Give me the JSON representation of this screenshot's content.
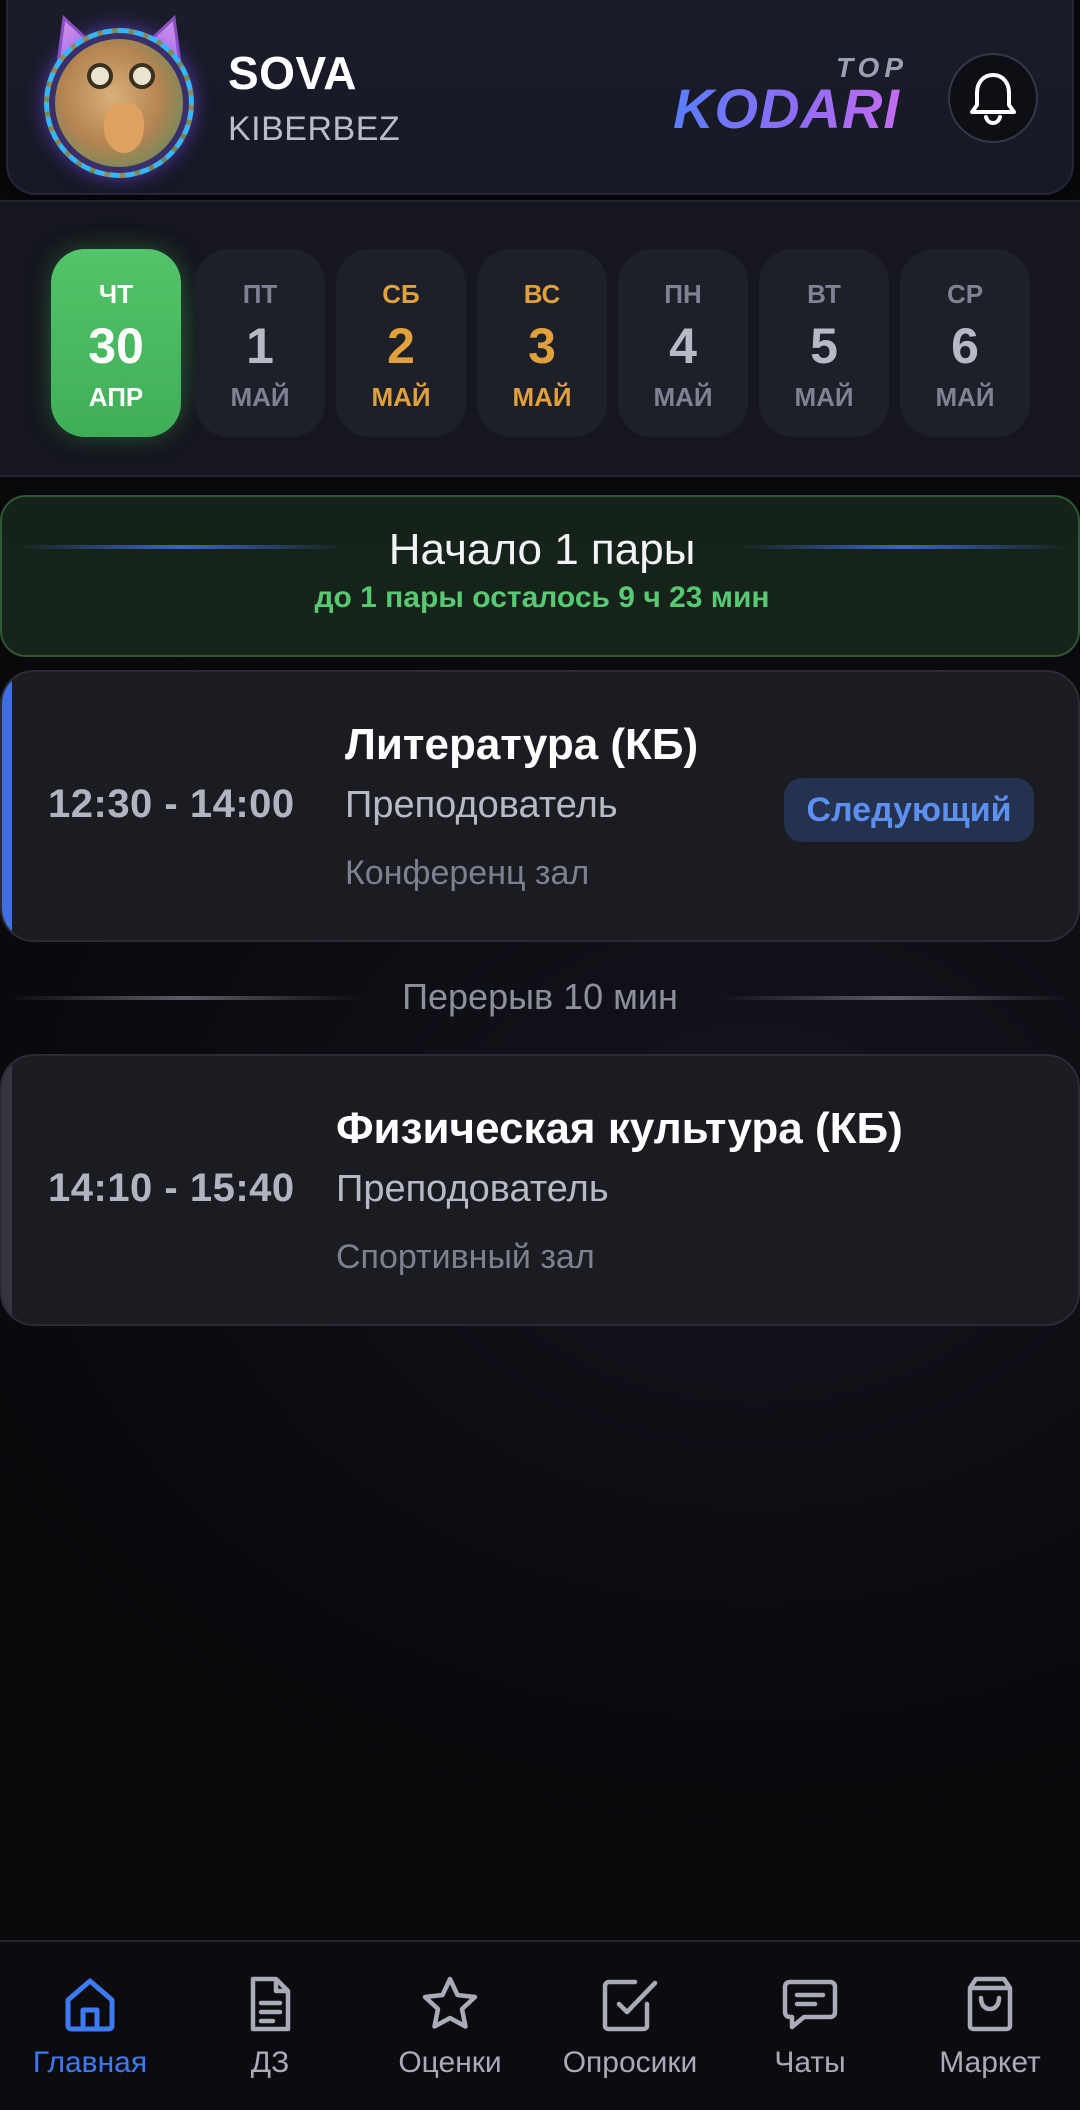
{
  "header": {
    "user_name": "SOVA",
    "group": "KIBERBEZ",
    "brand_top": "TOP",
    "brand_main": "KODARI"
  },
  "days": [
    {
      "dow": "ЧТ",
      "num": "30",
      "mon": "АПР",
      "state": "active"
    },
    {
      "dow": "ПТ",
      "num": "1",
      "mon": "МАЙ",
      "state": "normal"
    },
    {
      "dow": "СБ",
      "num": "2",
      "mon": "МАЙ",
      "state": "weekend"
    },
    {
      "dow": "ВС",
      "num": "3",
      "mon": "МАЙ",
      "state": "weekend"
    },
    {
      "dow": "ПН",
      "num": "4",
      "mon": "МАЙ",
      "state": "normal"
    },
    {
      "dow": "ВТ",
      "num": "5",
      "mon": "МАЙ",
      "state": "normal"
    },
    {
      "dow": "СР",
      "num": "6",
      "mon": "МАЙ",
      "state": "normal"
    }
  ],
  "banner": {
    "title": "Начало 1 пары",
    "subtitle": "до 1 пары осталось 9 ч 23 мин"
  },
  "lessons": [
    {
      "time": "12:30 - 14:00",
      "subject": "Литература (КБ)",
      "teacher": "Преподователь",
      "room": "Конференц зал",
      "badge": "Следующий"
    },
    {
      "time": "14:10 - 15:40",
      "subject": "Физическая культура (КБ)",
      "teacher": "Преподователь",
      "room": "Спортивный зал"
    }
  ],
  "break_label": "Перерыв 10 мин",
  "nav": [
    {
      "label": "Главная",
      "icon": "home-icon",
      "active": true
    },
    {
      "label": "ДЗ",
      "icon": "document-icon",
      "active": false
    },
    {
      "label": "Оценки",
      "icon": "star-icon",
      "active": false
    },
    {
      "label": "Опросики",
      "icon": "checkbox-icon",
      "active": false
    },
    {
      "label": "Чаты",
      "icon": "chat-icon",
      "active": false
    },
    {
      "label": "Маркет",
      "icon": "shopping-bag-icon",
      "active": false
    }
  ],
  "colors": {
    "accent_blue": "#3d7bf2",
    "active_day_green": "#4cbb63",
    "weekend_orange": "#e0a03c",
    "countdown_green": "#58c873"
  }
}
